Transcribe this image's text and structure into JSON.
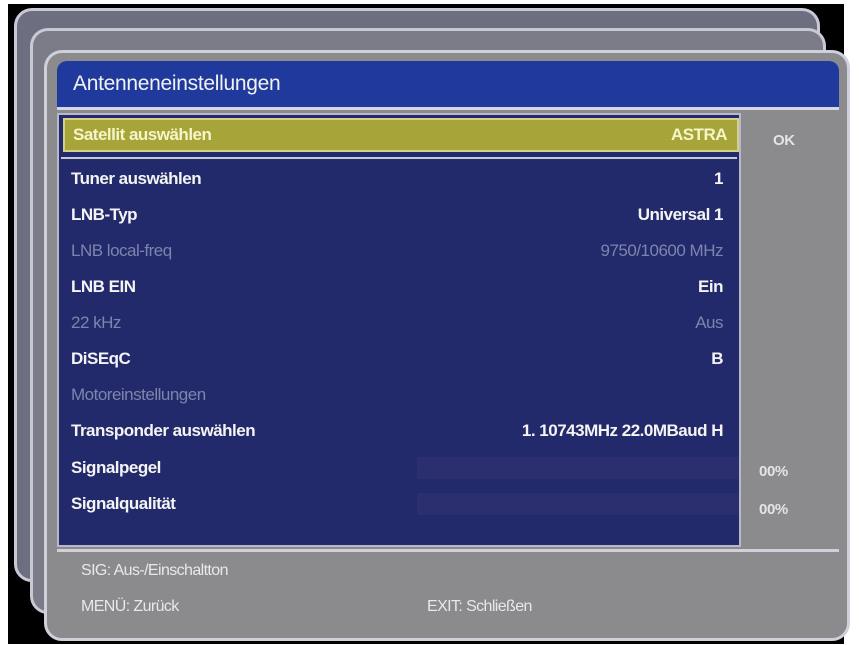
{
  "window": {
    "title": "Antenneneinstellungen"
  },
  "menu": {
    "rows": [
      {
        "label": "Satellit auswählen",
        "value": "ASTRA",
        "state": "selected"
      },
      {
        "label": "Tuner auswählen",
        "value": "1",
        "state": "enabled"
      },
      {
        "label": "LNB-Typ",
        "value": "Universal 1",
        "state": "enabled"
      },
      {
        "label": "LNB local-freq",
        "value": "9750/10600 MHz",
        "state": "disabled"
      },
      {
        "label": "LNB EIN",
        "value": "Ein",
        "state": "enabled"
      },
      {
        "label": "22 kHz",
        "value": "Aus",
        "state": "disabled"
      },
      {
        "label": "DiSEqC",
        "value": "B",
        "state": "enabled"
      },
      {
        "label": "Motoreinstellungen",
        "value": "",
        "state": "disabled"
      },
      {
        "label": "Transponder auswählen",
        "value": "1. 10743MHz 22.0MBaud H",
        "state": "enabled"
      }
    ],
    "signals": [
      {
        "label": "Signalpegel",
        "percent_text": "00%",
        "level": 0
      },
      {
        "label": "Signalqualität",
        "percent_text": "00%",
        "level": 0
      }
    ],
    "ok_label": "OK"
  },
  "footer": {
    "sig_hint": "SIG: Aus-/Einschaltton",
    "menu_hint": "MENÜ: Zurück",
    "exit_hint": "EXIT: Schließen"
  },
  "colors": {
    "title_bar": "#1f3a9c",
    "list_bg": "#232a6b",
    "selection": "#a7a43a",
    "panel": "#8b8b8d",
    "bar_track": "#a7abd8"
  }
}
